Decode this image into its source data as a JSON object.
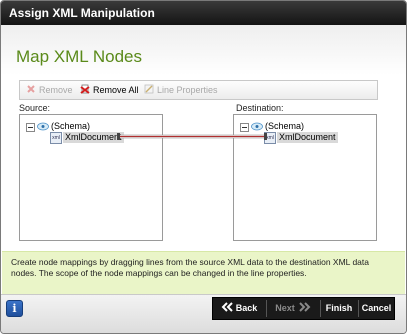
{
  "window": {
    "title": "Assign XML Manipulation"
  },
  "page": {
    "title": "Map XML Nodes"
  },
  "toolbar": {
    "remove_label": "Remove",
    "remove_all_label": "Remove All",
    "line_properties_label": "Line Properties"
  },
  "source": {
    "label": "Source:",
    "schema_label": "(Schema)",
    "node_label": "XmlDocument"
  },
  "destination": {
    "label": "Destination:",
    "schema_label": "(Schema)",
    "node_label": "XmlDocument"
  },
  "info_text": "Create node mappings by dragging lines from the source XML data to the destination XML data nodes. The scope of the node mappings can be changed in the line properties.",
  "footer": {
    "help_label": "i",
    "back_label": "Back",
    "next_label": "Next",
    "finish_label": "Finish",
    "cancel_label": "Cancel"
  },
  "colors": {
    "title_green": "#5a8a1a",
    "info_background": "#eaf5c8",
    "mapping_line": "#b03030"
  },
  "icons": [
    "remove-x-icon",
    "remove-all-icon",
    "line-properties-icon",
    "schema-icon",
    "xml-document-icon",
    "chevron-left-double-icon",
    "chevron-right-double-icon",
    "info-icon"
  ]
}
